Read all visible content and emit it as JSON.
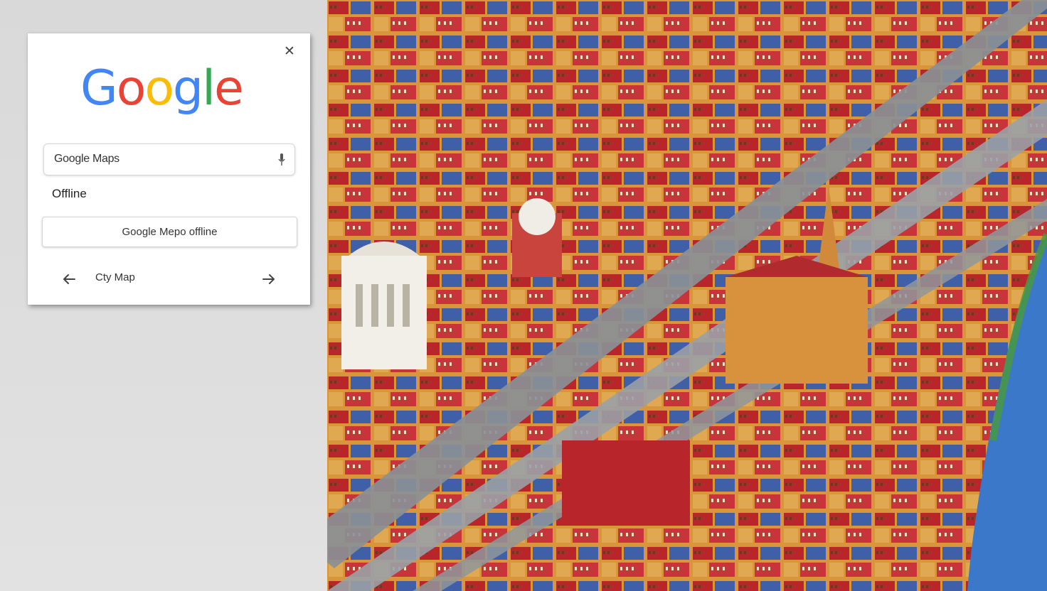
{
  "dialog": {
    "logo_letters": [
      {
        "char": "G",
        "color": "#4285F4"
      },
      {
        "char": "o",
        "color": "#EA4335"
      },
      {
        "char": "o",
        "color": "#FBBC05"
      },
      {
        "char": "g",
        "color": "#4285F4"
      },
      {
        "char": "l",
        "color": "#34A853"
      },
      {
        "char": "e",
        "color": "#EA4335"
      }
    ],
    "close_icon": "close-icon",
    "search": {
      "value": "Google Maps",
      "icon": "microphone-icon"
    },
    "offline_label": "Offline",
    "action_button_label": "Google Mepo offline",
    "nav": {
      "back_icon": "arrow-left-icon",
      "label": "Cty Map",
      "forward_icon": "arrow-right-icon"
    }
  },
  "map": {
    "style": "watercolor aerial city illustration",
    "colors": {
      "roof_red": "#b8262b",
      "roof_blue": "#3f5fa8",
      "wall_ochre": "#d9953a",
      "street": "#8a9096",
      "river": "#3b78c9"
    }
  }
}
